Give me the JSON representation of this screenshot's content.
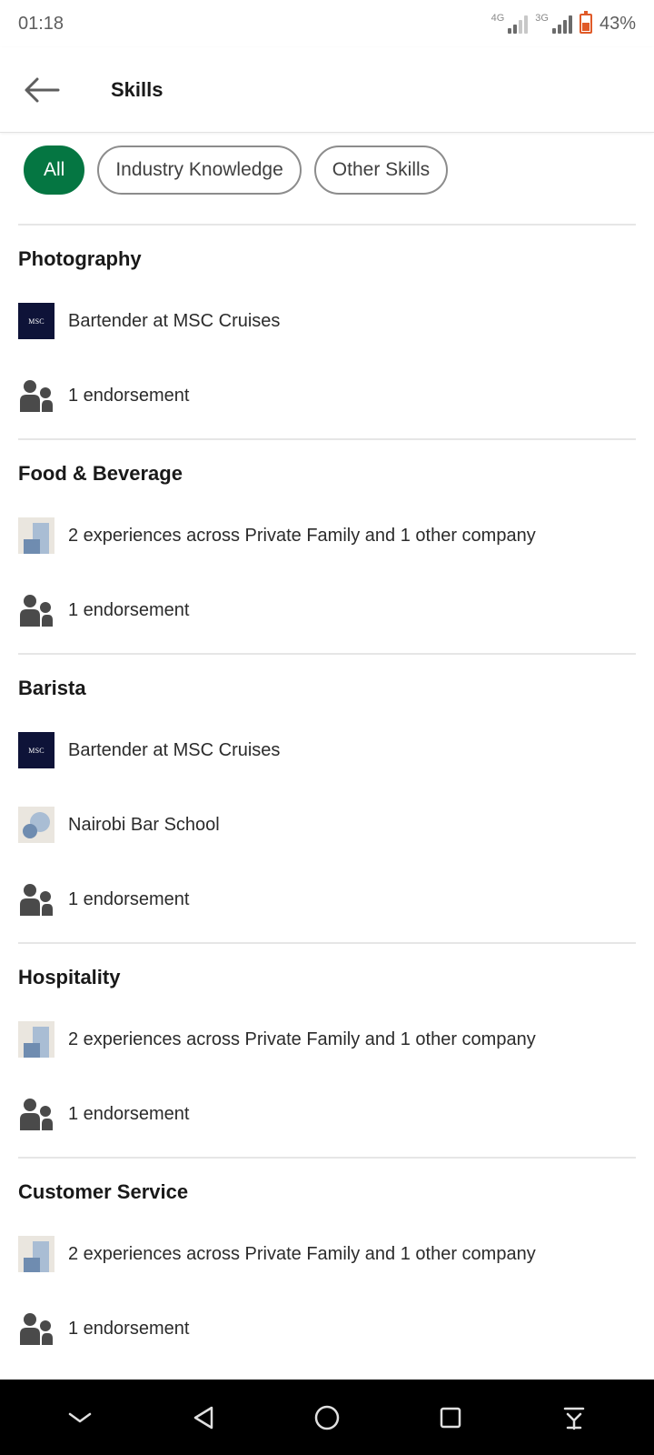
{
  "status": {
    "time": "01:18",
    "net1": "4G",
    "net2": "3G",
    "battery": "43%"
  },
  "header": {
    "title": "Skills"
  },
  "filters": [
    {
      "label": "All",
      "active": true
    },
    {
      "label": "Industry Knowledge",
      "active": false
    },
    {
      "label": "Other Skills",
      "active": false
    }
  ],
  "skills": [
    {
      "name": "Photography",
      "rows": [
        {
          "icon": "msc-logo",
          "text": "Bartender at MSC Cruises"
        },
        {
          "icon": "people-icon",
          "text": "1 endorsement"
        }
      ]
    },
    {
      "name": "Food & Beverage",
      "rows": [
        {
          "icon": "company-placeholder-icon",
          "text": "2 experiences across Private Family and 1 other company"
        },
        {
          "icon": "people-icon",
          "text": "1 endorsement"
        }
      ]
    },
    {
      "name": "Barista",
      "rows": [
        {
          "icon": "msc-logo",
          "text": "Bartender at MSC Cruises"
        },
        {
          "icon": "school-placeholder-icon",
          "text": "Nairobi Bar School"
        },
        {
          "icon": "people-icon",
          "text": "1 endorsement"
        }
      ]
    },
    {
      "name": "Hospitality",
      "rows": [
        {
          "icon": "company-placeholder-icon",
          "text": "2 experiences across Private Family and 1 other company"
        },
        {
          "icon": "people-icon",
          "text": "1 endorsement"
        }
      ]
    },
    {
      "name": "Customer Service",
      "rows": [
        {
          "icon": "company-placeholder-icon",
          "text": "2 experiences across Private Family and 1 other company"
        },
        {
          "icon": "people-icon",
          "text": "1 endorsement"
        }
      ]
    }
  ],
  "logo_text": {
    "msc": "MSC"
  },
  "colors": {
    "accent": "#057642",
    "nav_bar": "#000000"
  }
}
